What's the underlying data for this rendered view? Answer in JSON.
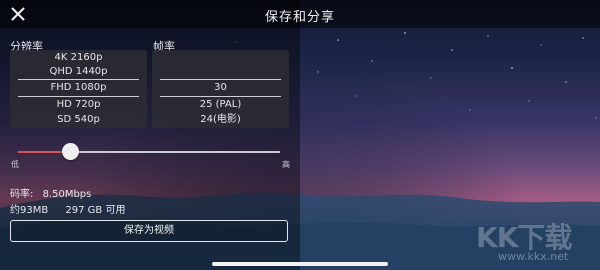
{
  "header": {
    "title": "保存和分享",
    "close_icon": "close-icon"
  },
  "resolution": {
    "label": "分辨率",
    "options": [
      "4K 2160p",
      "QHD 1440p",
      "FHD 1080p",
      "HD 720p",
      "SD 540p"
    ],
    "selected": "FHD 1080p"
  },
  "framerate": {
    "label": "帧率",
    "options": [
      "",
      "",
      "30",
      "25 (PAL)",
      "24(电影)"
    ],
    "selected": "30"
  },
  "quality_slider": {
    "low_label": "低",
    "high_label": "高",
    "level": 0.2
  },
  "bitrate": {
    "label": "码率:",
    "value": "8.50Mbps"
  },
  "size": {
    "estimate": "约93MB",
    "available": "297 GB 可用"
  },
  "save_button": {
    "label": "保存为视频"
  },
  "watermark": {
    "logo": "KK下载",
    "url": "www.kkx.net"
  },
  "colors": {
    "slider_active": "#d8555b",
    "slider_inactive": "#c9c9d2"
  }
}
